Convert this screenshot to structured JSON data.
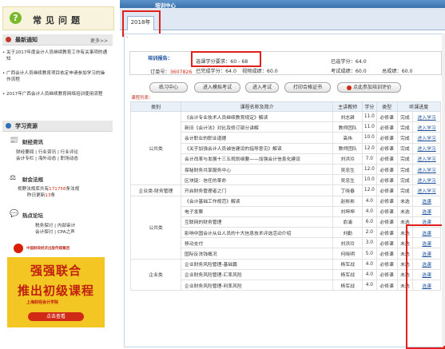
{
  "left": {
    "faq_title": "常见问题",
    "news": {
      "title": "最新通知",
      "more": "更多>>",
      "items": [
        "关于2017年度会计人员继续教育工作有关事项的通知",
        "广西会计人员继续教育项目依定申请参加学习的操作流程",
        "2017年广西会计人员继续教育网络培训使用流程"
      ]
    },
    "resources": {
      "title": "学习资源",
      "caijing_title": "财经资讯",
      "caijing_links": "财经要闻 | 行业资讯 | 行业评论\n会计专栏 | 海外动态 | 职场动态",
      "fagui_title": "财会法规",
      "fagui_text_pre": "视野法规库共有",
      "fagui_count": "171756",
      "fagui_text_mid": "条法规",
      "fagui_text2_pre": "昨日更新",
      "fagui_update": "13",
      "fagui_text2_post": "条",
      "luntan_title": "热点论坛",
      "luntan_links": "税务探讨 | 内部审计\n会计探讨 | CPA之声"
    },
    "ad": {
      "publisher": "中国财政经济出版传媒集团",
      "line1": "强强联合",
      "line2": "推出初级课程",
      "brand": "上海财经会计学院",
      "button": "点击查看"
    }
  },
  "right": {
    "top_title": "培训中心",
    "tab": "2018年",
    "report": {
      "label": "培训报告：",
      "credit_req": "选课学分要求：60 - 68",
      "selected": "已选学分：64.0",
      "order_label": "订单号：",
      "order_no": "3607826",
      "done": "已完成学分：64.0",
      "video": "视频成绩：60.0",
      "exam": "考试成绩：60.0",
      "total": "总成绩：60.0"
    },
    "buttons": [
      "练习中心",
      "进入模拟考试",
      "进入考试",
      "打印合格证书",
      "点此参加培训评价"
    ],
    "list_label": "课程列表：",
    "columns": [
      "类别",
      "课程名称及简介",
      "主讲教师",
      "学分",
      "类型",
      "听课进度"
    ],
    "rows": [
      {
        "cat": "公共类",
        "name": "《会计专业技术人员继续教育规定》解读",
        "teacher": "刘志耕",
        "credit": "11.0",
        "type": "必修课",
        "status": "完成",
        "action": "进入学习"
      },
      {
        "cat": "",
        "name": "新旧《会计法》对比及修订部分讲解",
        "teacher": "教师团队",
        "credit": "11.0",
        "type": "必修课",
        "status": "完成",
        "action": "进入学习"
      },
      {
        "cat": "",
        "name": "会计职业的职业道德",
        "teacher": "高伟",
        "credit": "10.0",
        "type": "必修课",
        "status": "完成",
        "action": "进入学习"
      },
      {
        "cat": "",
        "name": "《关于加强会计人员诚信建设的指导意见》解读",
        "teacher": "教师团队",
        "credit": "12.0",
        "type": "必修课",
        "status": "完成",
        "action": "进入学习"
      },
      {
        "cat": "",
        "name": "会计改革与发展十三五规划纲要——加强会计信息化建设",
        "teacher": "刘洪玲",
        "credit": "7.0",
        "type": "必修课",
        "status": "完成",
        "action": "进入学习"
      },
      {
        "cat": "",
        "name": "探秘财务共享服务中心",
        "teacher": "吴忠生",
        "credit": "12.0",
        "type": "必修课",
        "status": "完成",
        "action": "进入学习"
      },
      {
        "cat": "",
        "name": "区块链：信任的革命",
        "teacher": "吴忠生",
        "credit": "10.0",
        "type": "必修课",
        "status": "完成",
        "action": "进入学习"
      },
      {
        "cat": "企业类-财务管理",
        "name": "开启财务管理者之门",
        "teacher": "丁晓春",
        "credit": "12.0",
        "type": "必修课",
        "status": "完成",
        "action": "进入学习"
      },
      {
        "cat": "公共类",
        "name": "《会计基础工作规范》解读",
        "teacher": "赵彬彬",
        "credit": "4.0",
        "type": "必修课",
        "status": "未选",
        "action": "选课"
      },
      {
        "cat": "",
        "name": "电子发票",
        "teacher": "刘坤坤",
        "credit": "4.0",
        "type": "必修课",
        "status": "未选",
        "action": "选课"
      },
      {
        "cat": "",
        "name": "互联网的财务管理",
        "teacher": "俞浦",
        "credit": "6.0",
        "type": "必修课",
        "status": "未选",
        "action": "选课"
      },
      {
        "cat": "",
        "name": "影响中国会计从业人员的十大信息技术评选活动介绍",
        "teacher": "刘勤",
        "credit": "2.0",
        "type": "必修课",
        "status": "未选",
        "action": "选课"
      },
      {
        "cat": "",
        "name": "移动支付",
        "teacher": "刘洪玲",
        "credit": "3.0",
        "type": "必修课",
        "status": "未选",
        "action": "选课"
      },
      {
        "cat": "",
        "name": "国际反洗钱概况",
        "teacher": "何晓明",
        "credit": "5.0",
        "type": "必修课",
        "status": "未选",
        "action": "选课"
      },
      {
        "cat": "企业类",
        "name": "企业财务风险管理-基础篇",
        "teacher": "杨军战",
        "credit": "4.0",
        "type": "必修课",
        "status": "未选",
        "action": "选课"
      },
      {
        "cat": "",
        "name": "企业财务风险管理-汇率风险",
        "teacher": "杨军战",
        "credit": "4.0",
        "type": "必修课",
        "status": "未选",
        "action": "选课"
      },
      {
        "cat": "",
        "name": "企业财务风险管理-利率风险",
        "teacher": "杨军战",
        "credit": "4.0",
        "type": "必修课",
        "status": "未选",
        "action": "选课"
      }
    ]
  }
}
